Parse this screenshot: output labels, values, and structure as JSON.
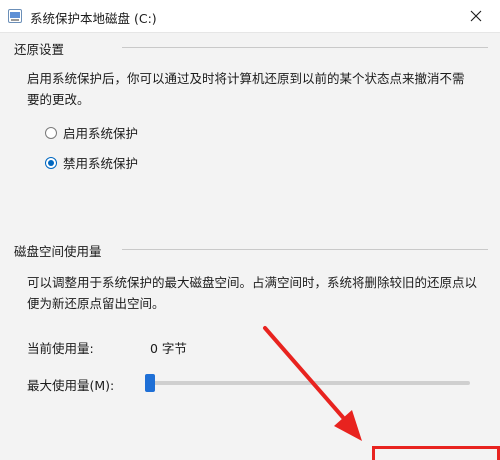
{
  "window": {
    "title": "系统保护本地磁盘 (C:)",
    "icons": {
      "app": "shield-icon",
      "close": "close-icon"
    }
  },
  "restore_settings": {
    "heading": "还原设置",
    "description_line1": "启用系统保护后，你可以通过及时将计算机还原到以前的某个状态点来撤消不需",
    "description_line2": "要的更改。",
    "options": [
      {
        "label": "启用系统保护",
        "selected": false
      },
      {
        "label": "禁用系统保护",
        "selected": true
      }
    ]
  },
  "disk_usage": {
    "heading": "磁盘空间使用量",
    "description_line1": "可以调整用于系统保护的最大磁盘空间。占满空间时，系统将删除较旧的还原点以",
    "description_line2": "便为新还原点留出空间。",
    "current_label": "当前使用量:",
    "current_value": "0 字节",
    "max_label": "最大使用量(M):",
    "max_usage_fraction": 0.0
  },
  "colors": {
    "accent": "#0067c0",
    "annotation": "#e8231f"
  }
}
